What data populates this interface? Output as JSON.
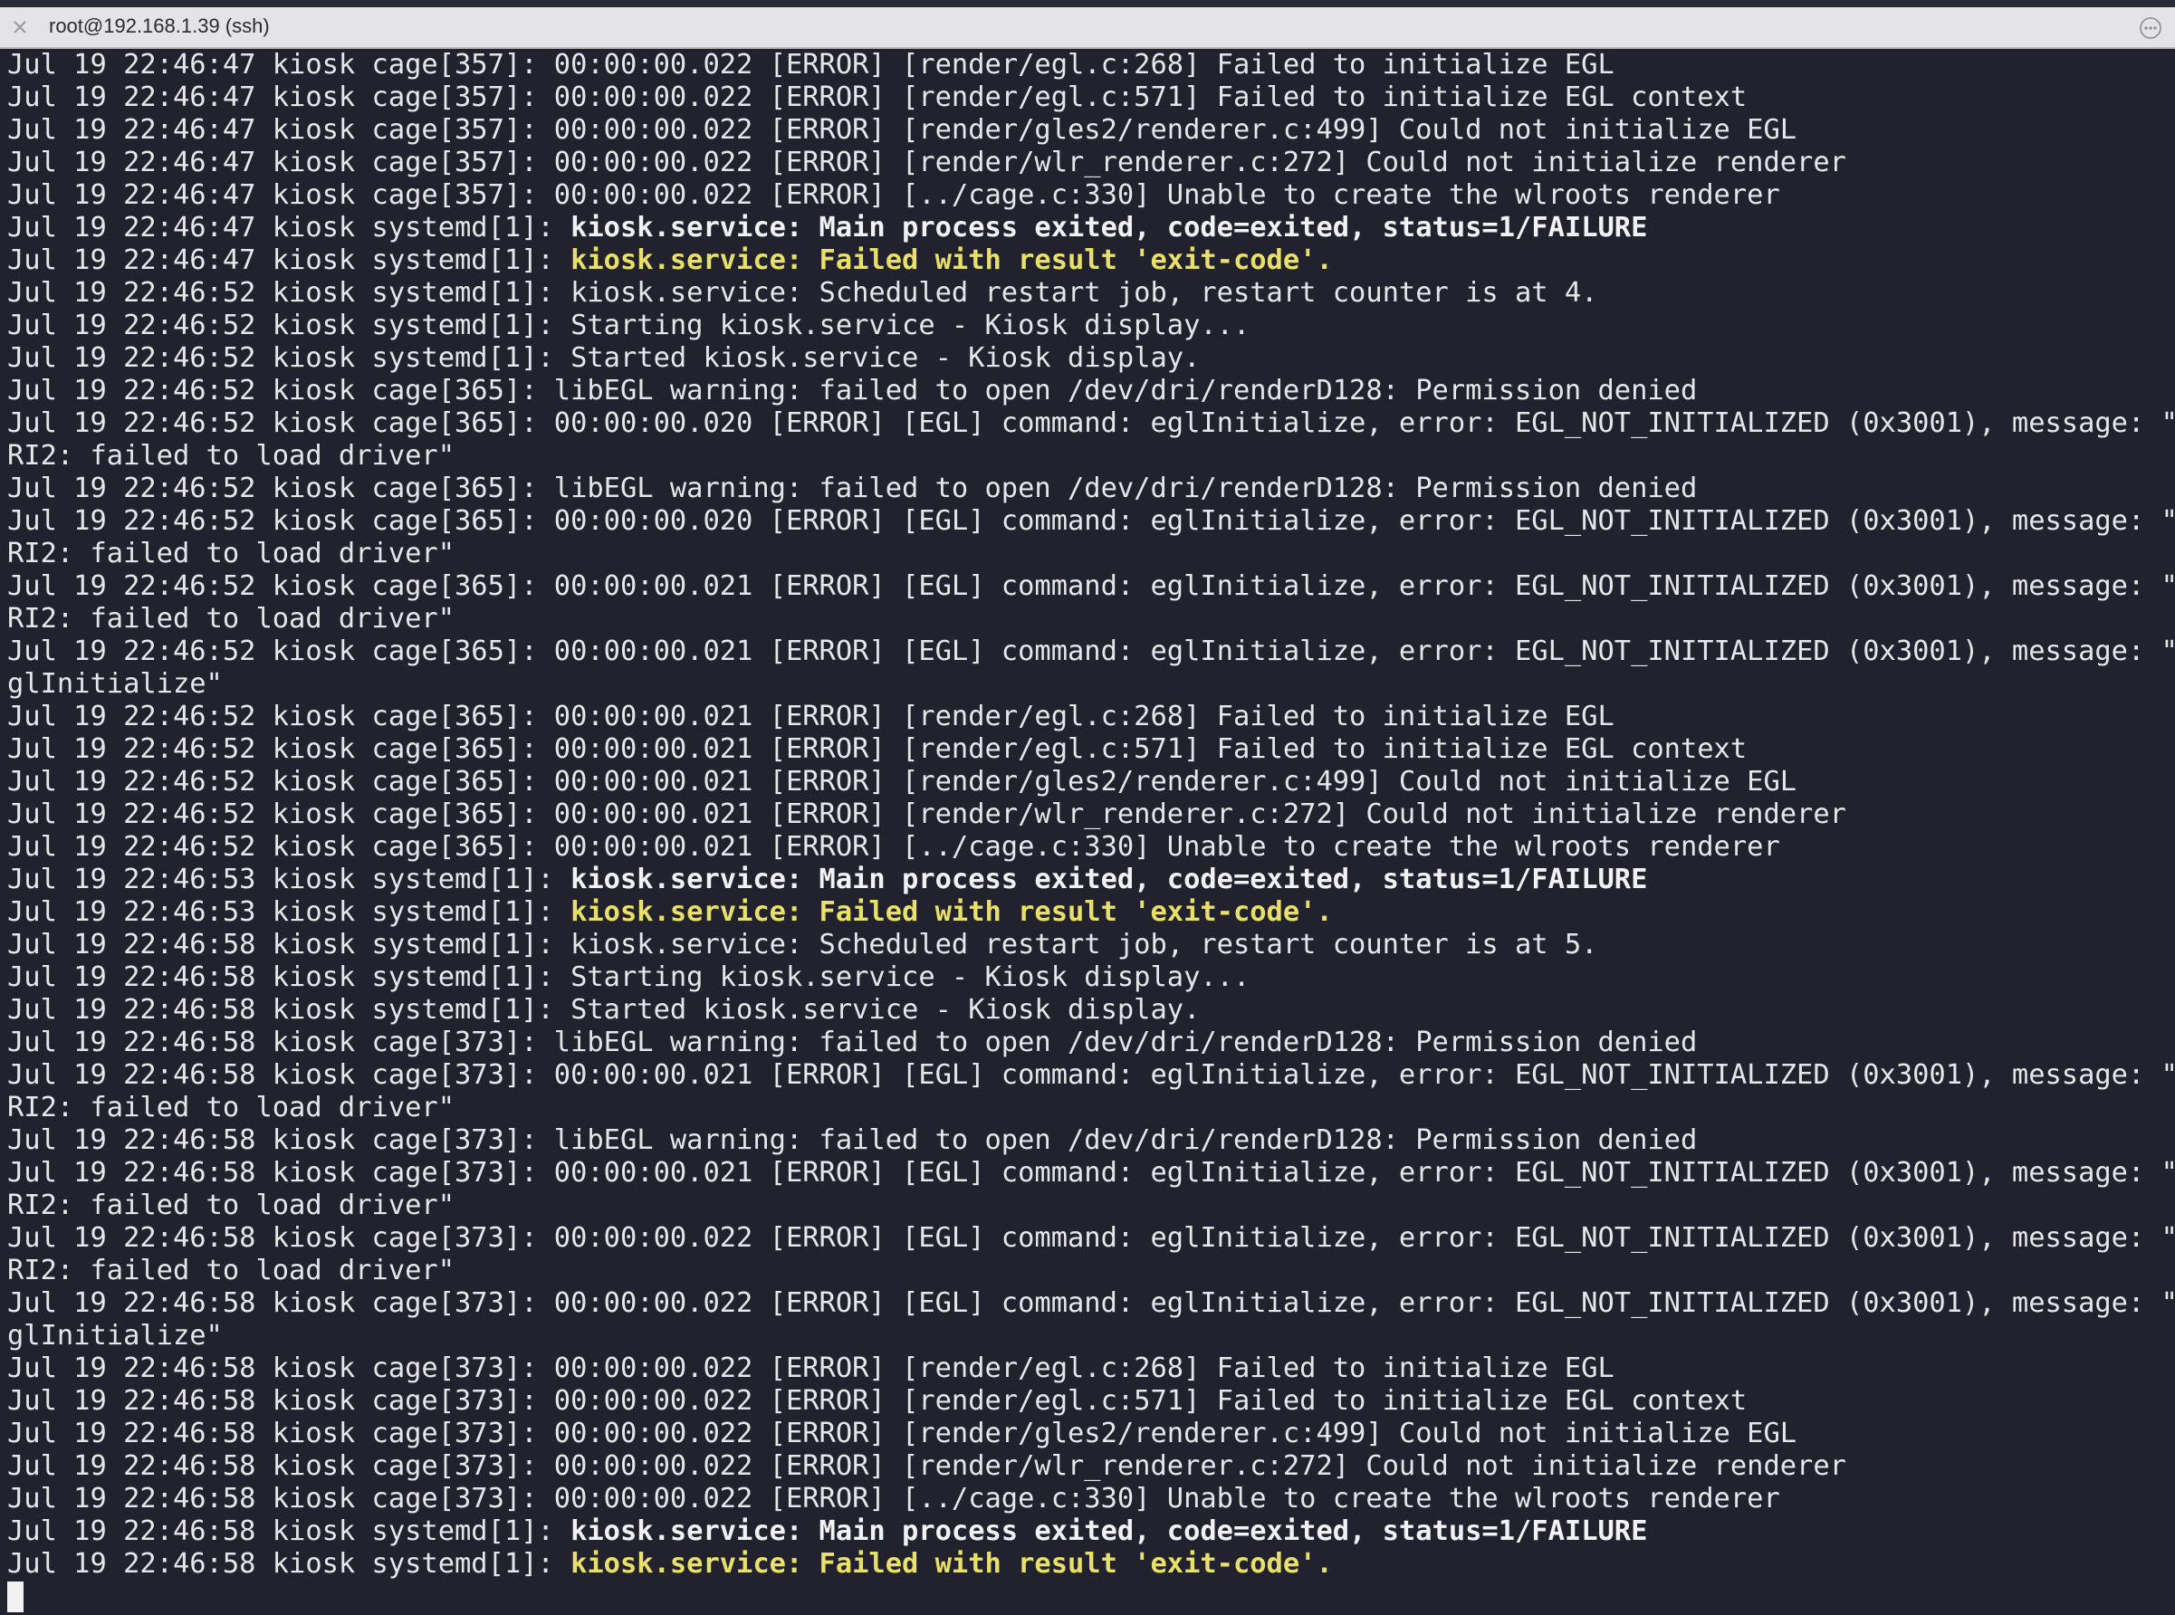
{
  "window": {
    "title": "root@192.168.1.39 (ssh)"
  },
  "colors": {
    "background": "#21222e",
    "text": "#e6e6ea",
    "highlight_yellow": "#e8e06a",
    "titlebar": "#e4e4e6"
  },
  "icons": {
    "close": "close-icon",
    "more": "more-options-icon"
  },
  "terminal": {
    "lines": [
      {
        "prefix": "Jul 19 22:46:47 kiosk cage[357]: 00:00:00.022 [ERROR] [render/egl.c:268] Failed to initialize EGL",
        "msg": "",
        "style": "plain"
      },
      {
        "prefix": "Jul 19 22:46:47 kiosk cage[357]: 00:00:00.022 [ERROR] [render/egl.c:571] Failed to initialize EGL context",
        "msg": "",
        "style": "plain"
      },
      {
        "prefix": "Jul 19 22:46:47 kiosk cage[357]: 00:00:00.022 [ERROR] [render/gles2/renderer.c:499] Could not initialize EGL",
        "msg": "",
        "style": "plain"
      },
      {
        "prefix": "Jul 19 22:46:47 kiosk cage[357]: 00:00:00.022 [ERROR] [render/wlr_renderer.c:272] Could not initialize renderer",
        "msg": "",
        "style": "plain"
      },
      {
        "prefix": "Jul 19 22:46:47 kiosk cage[357]: 00:00:00.022 [ERROR] [../cage.c:330] Unable to create the wlroots renderer",
        "msg": "",
        "style": "plain"
      },
      {
        "prefix": "Jul 19 22:46:47 kiosk systemd[1]: ",
        "msg": "kiosk.service: Main process exited, code=exited, status=1/FAILURE",
        "style": "bold"
      },
      {
        "prefix": "Jul 19 22:46:47 kiosk systemd[1]: ",
        "msg": "kiosk.service: Failed with result 'exit-code'.",
        "style": "yellow"
      },
      {
        "prefix": "Jul 19 22:46:52 kiosk systemd[1]: kiosk.service: Scheduled restart job, restart counter is at 4.",
        "msg": "",
        "style": "plain"
      },
      {
        "prefix": "Jul 19 22:46:52 kiosk systemd[1]: Starting kiosk.service - Kiosk display...",
        "msg": "",
        "style": "plain"
      },
      {
        "prefix": "Jul 19 22:46:52 kiosk systemd[1]: Started kiosk.service - Kiosk display.",
        "msg": "",
        "style": "plain"
      },
      {
        "prefix": "Jul 19 22:46:52 kiosk cage[365]: libEGL warning: failed to open /dev/dri/renderD128: Permission denied",
        "msg": "",
        "style": "plain"
      },
      {
        "prefix": "Jul 19 22:46:52 kiosk cage[365]: 00:00:00.020 [ERROR] [EGL] command: eglInitialize, error: EGL_NOT_INITIALIZED (0x3001), message: \"D",
        "msg": "",
        "style": "plain"
      },
      {
        "prefix": "RI2: failed to load driver\"",
        "msg": "",
        "style": "plain"
      },
      {
        "prefix": "Jul 19 22:46:52 kiosk cage[365]: libEGL warning: failed to open /dev/dri/renderD128: Permission denied",
        "msg": "",
        "style": "plain"
      },
      {
        "prefix": "Jul 19 22:46:52 kiosk cage[365]: 00:00:00.020 [ERROR] [EGL] command: eglInitialize, error: EGL_NOT_INITIALIZED (0x3001), message: \"D",
        "msg": "",
        "style": "plain"
      },
      {
        "prefix": "RI2: failed to load driver\"",
        "msg": "",
        "style": "plain"
      },
      {
        "prefix": "Jul 19 22:46:52 kiosk cage[365]: 00:00:00.021 [ERROR] [EGL] command: eglInitialize, error: EGL_NOT_INITIALIZED (0x3001), message: \"D",
        "msg": "",
        "style": "plain"
      },
      {
        "prefix": "RI2: failed to load driver\"",
        "msg": "",
        "style": "plain"
      },
      {
        "prefix": "Jul 19 22:46:52 kiosk cage[365]: 00:00:00.021 [ERROR] [EGL] command: eglInitialize, error: EGL_NOT_INITIALIZED (0x3001), message: \"e",
        "msg": "",
        "style": "plain"
      },
      {
        "prefix": "glInitialize\"",
        "msg": "",
        "style": "plain"
      },
      {
        "prefix": "Jul 19 22:46:52 kiosk cage[365]: 00:00:00.021 [ERROR] [render/egl.c:268] Failed to initialize EGL",
        "msg": "",
        "style": "plain"
      },
      {
        "prefix": "Jul 19 22:46:52 kiosk cage[365]: 00:00:00.021 [ERROR] [render/egl.c:571] Failed to initialize EGL context",
        "msg": "",
        "style": "plain"
      },
      {
        "prefix": "Jul 19 22:46:52 kiosk cage[365]: 00:00:00.021 [ERROR] [render/gles2/renderer.c:499] Could not initialize EGL",
        "msg": "",
        "style": "plain"
      },
      {
        "prefix": "Jul 19 22:46:52 kiosk cage[365]: 00:00:00.021 [ERROR] [render/wlr_renderer.c:272] Could not initialize renderer",
        "msg": "",
        "style": "plain"
      },
      {
        "prefix": "Jul 19 22:46:52 kiosk cage[365]: 00:00:00.021 [ERROR] [../cage.c:330] Unable to create the wlroots renderer",
        "msg": "",
        "style": "plain"
      },
      {
        "prefix": "Jul 19 22:46:53 kiosk systemd[1]: ",
        "msg": "kiosk.service: Main process exited, code=exited, status=1/FAILURE",
        "style": "bold"
      },
      {
        "prefix": "Jul 19 22:46:53 kiosk systemd[1]: ",
        "msg": "kiosk.service: Failed with result 'exit-code'.",
        "style": "yellow"
      },
      {
        "prefix": "Jul 19 22:46:58 kiosk systemd[1]: kiosk.service: Scheduled restart job, restart counter is at 5.",
        "msg": "",
        "style": "plain"
      },
      {
        "prefix": "Jul 19 22:46:58 kiosk systemd[1]: Starting kiosk.service - Kiosk display...",
        "msg": "",
        "style": "plain"
      },
      {
        "prefix": "Jul 19 22:46:58 kiosk systemd[1]: Started kiosk.service - Kiosk display.",
        "msg": "",
        "style": "plain"
      },
      {
        "prefix": "Jul 19 22:46:58 kiosk cage[373]: libEGL warning: failed to open /dev/dri/renderD128: Permission denied",
        "msg": "",
        "style": "plain"
      },
      {
        "prefix": "Jul 19 22:46:58 kiosk cage[373]: 00:00:00.021 [ERROR] [EGL] command: eglInitialize, error: EGL_NOT_INITIALIZED (0x3001), message: \"D",
        "msg": "",
        "style": "plain"
      },
      {
        "prefix": "RI2: failed to load driver\"",
        "msg": "",
        "style": "plain"
      },
      {
        "prefix": "Jul 19 22:46:58 kiosk cage[373]: libEGL warning: failed to open /dev/dri/renderD128: Permission denied",
        "msg": "",
        "style": "plain"
      },
      {
        "prefix": "Jul 19 22:46:58 kiosk cage[373]: 00:00:00.021 [ERROR] [EGL] command: eglInitialize, error: EGL_NOT_INITIALIZED (0x3001), message: \"D",
        "msg": "",
        "style": "plain"
      },
      {
        "prefix": "RI2: failed to load driver\"",
        "msg": "",
        "style": "plain"
      },
      {
        "prefix": "Jul 19 22:46:58 kiosk cage[373]: 00:00:00.022 [ERROR] [EGL] command: eglInitialize, error: EGL_NOT_INITIALIZED (0x3001), message: \"D",
        "msg": "",
        "style": "plain"
      },
      {
        "prefix": "RI2: failed to load driver\"",
        "msg": "",
        "style": "plain"
      },
      {
        "prefix": "Jul 19 22:46:58 kiosk cage[373]: 00:00:00.022 [ERROR] [EGL] command: eglInitialize, error: EGL_NOT_INITIALIZED (0x3001), message: \"e",
        "msg": "",
        "style": "plain"
      },
      {
        "prefix": "glInitialize\"",
        "msg": "",
        "style": "plain"
      },
      {
        "prefix": "Jul 19 22:46:58 kiosk cage[373]: 00:00:00.022 [ERROR] [render/egl.c:268] Failed to initialize EGL",
        "msg": "",
        "style": "plain"
      },
      {
        "prefix": "Jul 19 22:46:58 kiosk cage[373]: 00:00:00.022 [ERROR] [render/egl.c:571] Failed to initialize EGL context",
        "msg": "",
        "style": "plain"
      },
      {
        "prefix": "Jul 19 22:46:58 kiosk cage[373]: 00:00:00.022 [ERROR] [render/gles2/renderer.c:499] Could not initialize EGL",
        "msg": "",
        "style": "plain"
      },
      {
        "prefix": "Jul 19 22:46:58 kiosk cage[373]: 00:00:00.022 [ERROR] [render/wlr_renderer.c:272] Could not initialize renderer",
        "msg": "",
        "style": "plain"
      },
      {
        "prefix": "Jul 19 22:46:58 kiosk cage[373]: 00:00:00.022 [ERROR] [../cage.c:330] Unable to create the wlroots renderer",
        "msg": "",
        "style": "plain"
      },
      {
        "prefix": "Jul 19 22:46:58 kiosk systemd[1]: ",
        "msg": "kiosk.service: Main process exited, code=exited, status=1/FAILURE",
        "style": "bold"
      },
      {
        "prefix": "Jul 19 22:46:58 kiosk systemd[1]: ",
        "msg": "kiosk.service: Failed with result 'exit-code'.",
        "style": "yellow"
      }
    ]
  }
}
